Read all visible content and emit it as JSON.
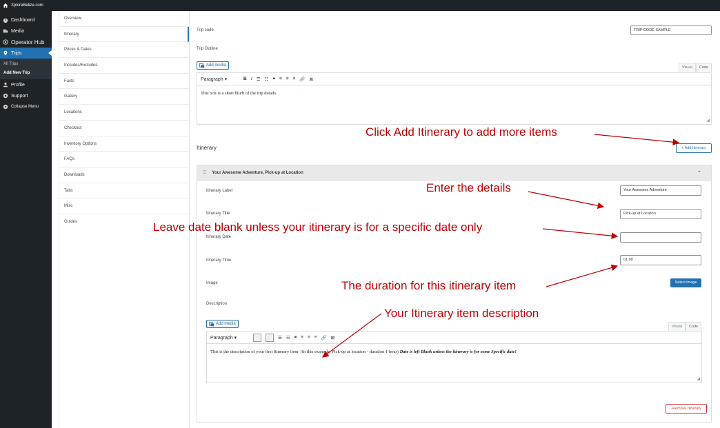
{
  "site": {
    "title": "XploreBelize.com"
  },
  "sidebar": {
    "items": [
      {
        "label": "Dashboard",
        "icon": "dashboard-icon"
      },
      {
        "label": "Media",
        "icon": "media-icon"
      },
      {
        "label": "Operator Hub",
        "icon": "operator-hub-icon"
      },
      {
        "label": "Trips",
        "icon": "trips-pin-icon"
      },
      {
        "label": "Profile",
        "icon": "profile-icon"
      },
      {
        "label": "Support",
        "icon": "support-icon"
      },
      {
        "label": "Collapse Menu",
        "icon": "collapse-icon"
      }
    ],
    "subitems": [
      "All Trips",
      "Add New Trip"
    ]
  },
  "tabs": [
    "Overview",
    "Itinerary",
    "Prices & Dates",
    "Includes/Excludes",
    "Facts",
    "Gallery",
    "Locations",
    "Checkout",
    "Inventory Options",
    "FAQs",
    "Downloads",
    "Tabs",
    "Misc",
    "Guides"
  ],
  "form": {
    "trip_code_label": "Trip code",
    "trip_code_value": "TRIP CODE SAMPLE",
    "trip_outline_label": "Trip Outline",
    "add_media": "Add media",
    "visual": "Visual",
    "code": "Code",
    "paragraph": "Paragraph",
    "outline_text": "This text is a short blurb of the trip details.",
    "itinerary_heading": "Itinerary",
    "add_itinerary": "+ Add Itinerary"
  },
  "itinerary": {
    "header": "Your Awesome Adventure, Pick-up at Location",
    "label_label": "Itinerary Label",
    "label_value": "Your Awesome Adventure",
    "title_label": "Itinerary Title",
    "title_value": "Pick-up at Location",
    "date_label": "Itinerary Date",
    "date_value": "",
    "time_label": "Itinerary Time",
    "time_value": "01:00",
    "image_label": "Image",
    "select_image": "Select image",
    "description_label": "Description",
    "desc_text": "This is the description of your first Itinerary item. (In this example, Pick-up at location - duration 1 hour)",
    "desc_bold": "Date is left Blank unless the itinerary is for some Specific date!",
    "remove": "-Remove Itinerary"
  },
  "annotations": {
    "add": "Click Add Itinerary to add more items",
    "details": "Enter the details",
    "date": "Leave date blank unless your itinerary is for a specific date only",
    "duration": "The duration for this itinerary item",
    "description": "Your Itinerary item description"
  },
  "colors": {
    "annotation": "#c00000",
    "accent": "#2271b1",
    "admin_bar": "#1d2327",
    "remove": "#d63638"
  }
}
